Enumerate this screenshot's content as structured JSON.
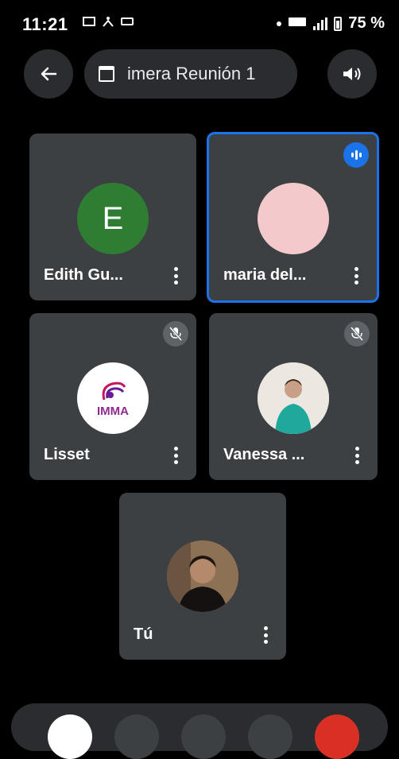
{
  "status_bar": {
    "time": "11:21",
    "battery": "75 %"
  },
  "top_bar": {
    "meeting_title": "imera Reunión 1"
  },
  "participants": [
    {
      "name": "Edith Gu...",
      "initial": "E",
      "muted": false,
      "speaking": false
    },
    {
      "name": "maria del...",
      "muted": false,
      "speaking": true
    },
    {
      "name": "Lisset",
      "muted": true,
      "speaking": false,
      "avatar_text": "IMMA"
    },
    {
      "name": "Vanessa ...",
      "muted": true,
      "speaking": false
    },
    {
      "name": "Tú",
      "muted": false,
      "speaking": false
    }
  ],
  "colors": {
    "accent": "#1a73e8",
    "tile_bg": "#3c4043",
    "edith_avatar": "#2e7d32",
    "end_call": "#d93025"
  }
}
